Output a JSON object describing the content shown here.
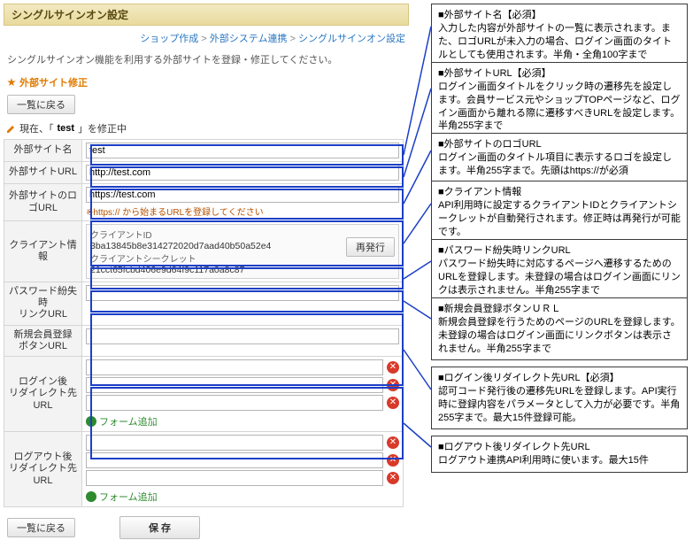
{
  "header": {
    "title": "シングルサインオン設定"
  },
  "breadcrumb": {
    "a": "ショップ作成",
    "sep": " > ",
    "b": "外部システム連携",
    "c": "シングルサインオン設定"
  },
  "intro": "シングルサインオン機能を利用する外部サイトを登録・修正してください。",
  "section_edit": "外部サイト修正",
  "btn_back": "一覧に戻る",
  "editing": {
    "pre": "現在、「",
    "name": "test",
    "post": "」を修正中"
  },
  "labels": {
    "site_name": "外部サイト名",
    "site_url": "外部サイトURL",
    "logo_url": "外部サイトのロゴURL",
    "client": "クライアント情報",
    "pwlost": "パスワード紛失時\nリンクURL",
    "newmem": "新規会員登録\nボタンURL",
    "login_r": "ログイン後\nリダイレクト先URL",
    "logout_r": "ログアウト後\nリダイレクト先URL"
  },
  "values": {
    "site_name": "test",
    "site_url": "http://test.com",
    "logo_url": "https://test.com",
    "logo_hint": "※https:// から始まるURLを登録してください",
    "client_id_lbl": "クライアントID",
    "client_id": "3ba13845b8e314272020d7aad40b50a52e4",
    "client_sec_lbl": "クライアントシークレット",
    "client_sec": "21cct65fcbd406e9d64f9c117a0a8c87",
    "reissue": "再発行"
  },
  "add_label": "フォーム追加",
  "save": "保 存",
  "ann": [
    {
      "t": "■外部サイト名【必須】",
      "b": "入力した内容が外部サイトの一覧に表示されます。また、ロゴURLが未入力の場合、ログイン画面のタイトルとしても使用されます。半角・全角100字まで"
    },
    {
      "t": "■外部サイトURL【必須】",
      "b": "ログイン画面タイトルをクリック時の遷移先を設定します。会員サービス元やショップTOPページなど、ログイン画面から離れる際に遷移すべきURLを設定します。半角255字まで"
    },
    {
      "t": "■外部サイトのロゴURL",
      "b": "ログイン画面のタイトル項目に表示するロゴを設定します。半角255字まで。先頭はhttps://が必須"
    },
    {
      "t": "■クライアント情報",
      "b": "API利用時に設定するクライアントIDとクライアントシークレットが自動発行されます。修正時は再発行が可能です。"
    },
    {
      "t": "■パスワード紛失時リンクURL",
      "b": "パスワード紛失時に対応するページへ遷移するためのURLを登録します。未登録の場合はログイン画面にリンクは表示されません。半角255字まで"
    },
    {
      "t": "■新規会員登録ボタンＵＲＬ",
      "b": "新規会員登録を行うためのページのURLを登録します。未登録の場合はログイン画面にリンクボタンは表示されません。半角255字まで"
    },
    {
      "t": "■ログイン後リダイレクト先URL【必須】",
      "b": "認可コード発行後の遷移先URLを登録します。API実行時に登録内容をパラメータとして入力が必要です。半角255字まで。最大15件登録可能。"
    },
    {
      "t": "■ログアウト後リダイレクト先URL",
      "b": "ログアウト連携API利用時に使います。最大15件"
    }
  ]
}
